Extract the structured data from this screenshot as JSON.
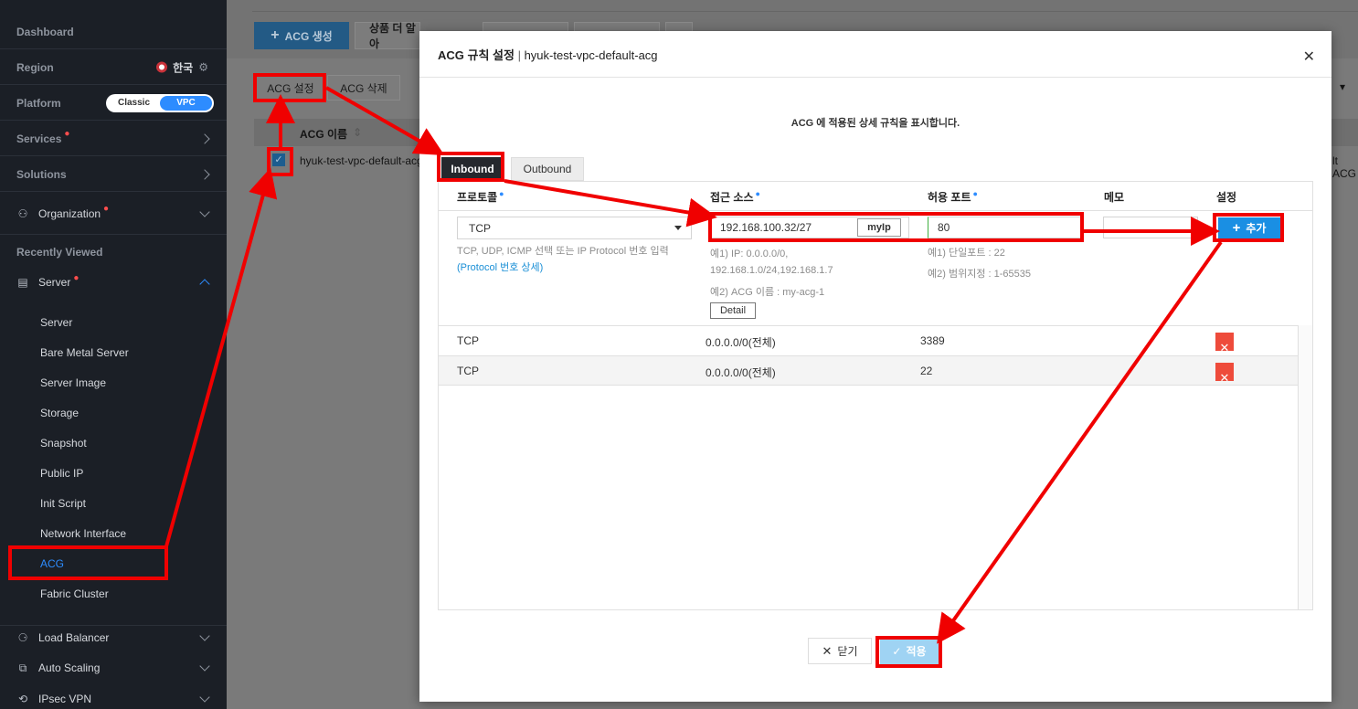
{
  "sidebar": {
    "dashboard": "Dashboard",
    "region_label": "Region",
    "region_value": "한국",
    "platform_label": "Platform",
    "platform_classic": "Classic",
    "platform_vpc": "VPC",
    "services": "Services",
    "solutions": "Solutions",
    "organization": "Organization",
    "recently_viewed": "Recently Viewed",
    "server": "Server",
    "server_items": [
      "Server",
      "Bare Metal Server",
      "Server Image",
      "Storage",
      "Snapshot",
      "Public IP",
      "Init Script",
      "Network Interface",
      "ACG",
      "Fabric Cluster"
    ],
    "load_balancer": "Load Balancer",
    "auto_scaling": "Auto Scaling",
    "ipsec_vpn": "IPsec VPN"
  },
  "background": {
    "create_acg": "ACG 생성",
    "more_products": "상품 더 알아",
    "acg_settings": "ACG 설정",
    "acg_delete": "ACG 삭제",
    "col_acg_name": "ACG 이름",
    "row_acg_name": "hyuk-test-vpc-default-acg",
    "row_right_text": "lt ACG"
  },
  "modal": {
    "title": "ACG 규칙 설정",
    "subtitle": "hyuk-test-vpc-default-acg",
    "description": "ACG 에 적용된 상세 규칙을 표시합니다.",
    "tab_inbound": "Inbound",
    "tab_outbound": "Outbound",
    "columns": {
      "protocol": "프로토콜",
      "source": "접근 소스",
      "port": "허용 포트",
      "memo": "메모",
      "settings": "설정"
    },
    "form": {
      "protocol_value": "TCP",
      "protocol_help": "TCP, UDP, ICMP 선택 또는 IP Protocol 번호 입력",
      "protocol_link_open": "(",
      "protocol_link": "Protocol 번호 상세",
      "protocol_link_close": ")",
      "source_value": "192.168.100.32/27",
      "myip_label": "myIp",
      "source_help_1": "예1) IP: 0.0.0.0/0,",
      "source_help_2": "192.168.1.0/24,192.168.1.7",
      "source_help_3": "예2) ACG 이름 : my-acg-1",
      "detail_label": "Detail",
      "port_value": "80",
      "port_help_1": "예1) 단일포트 : 22",
      "port_help_2": "예2) 범위지정 : 1-65535",
      "memo_value": "",
      "add_label": "추가"
    },
    "rules": [
      {
        "protocol": "TCP",
        "source": "0.0.0.0/0(전체)",
        "port": "3389"
      },
      {
        "protocol": "TCP",
        "source": "0.0.0.0/0(전체)",
        "port": "22"
      }
    ],
    "close_label": "닫기",
    "apply_label": "적용"
  },
  "colors": {
    "accent": "#2d8cff",
    "annotation": "#f00000",
    "delete": "#ee4b3b"
  }
}
